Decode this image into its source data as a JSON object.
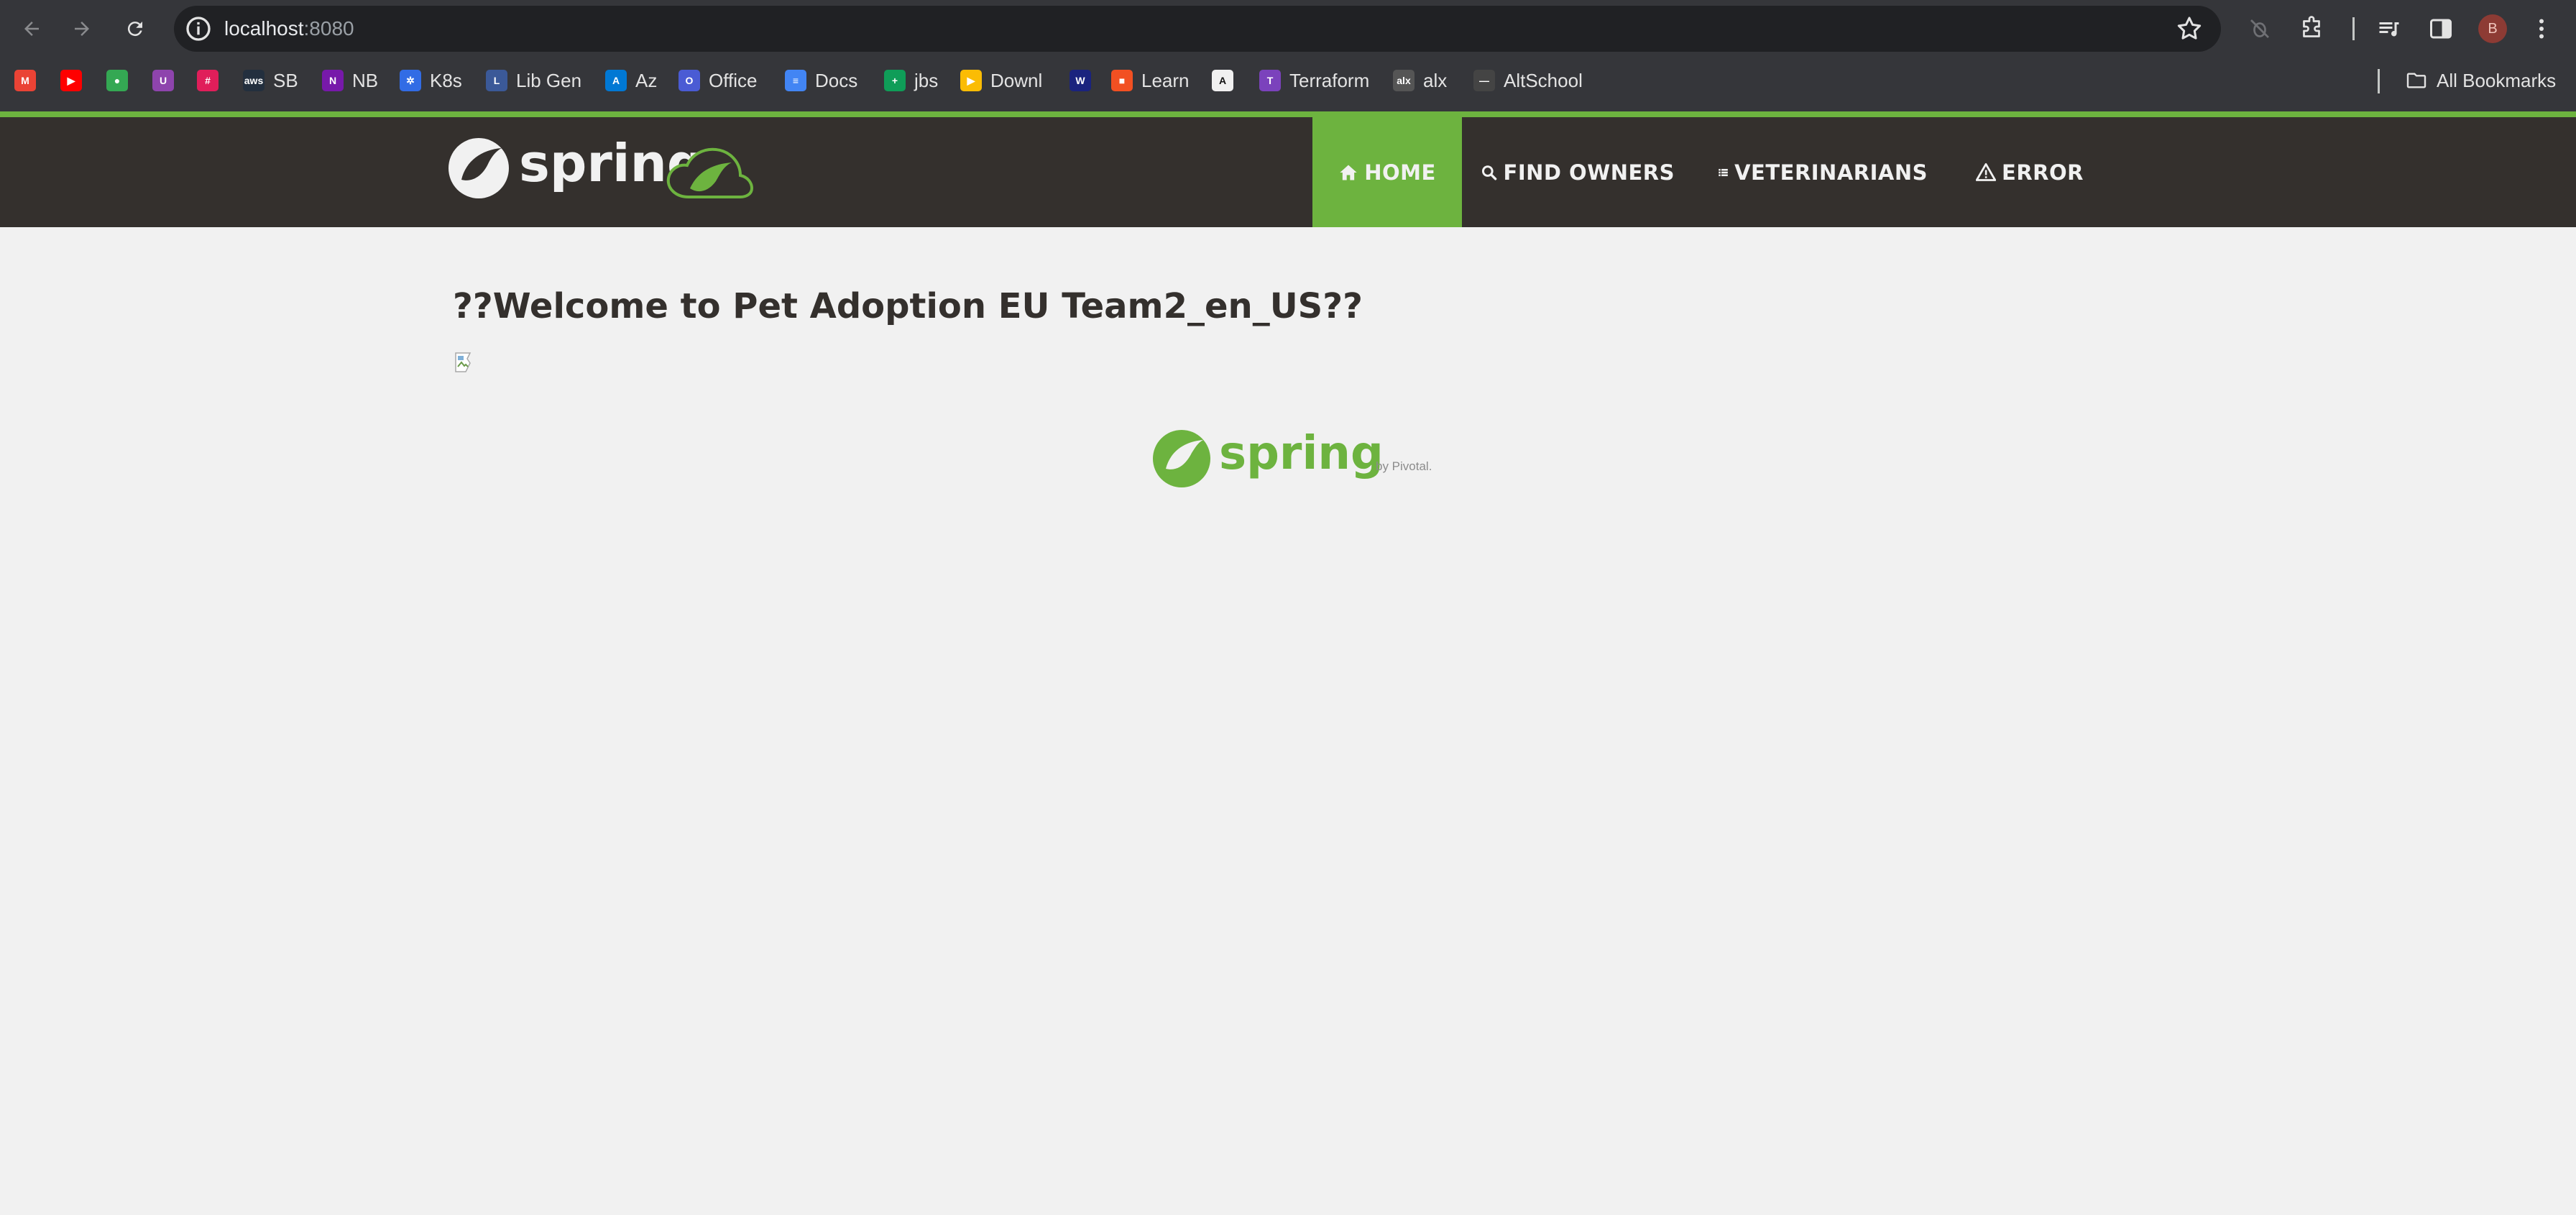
{
  "browser": {
    "url_host": "localhost",
    "url_port": ":8080",
    "profile_initial": "B"
  },
  "bookmarks": [
    {
      "label": "",
      "icon": "gmail-icon",
      "color": "#ea4335"
    },
    {
      "label": "",
      "icon": "youtube-icon",
      "color": "#ff0000"
    },
    {
      "label": "",
      "icon": "maps-icon",
      "color": "#34a853"
    },
    {
      "label": "",
      "icon": "extension-u-icon",
      "color": "#8e44ad"
    },
    {
      "label": "",
      "icon": "slack-icon",
      "color": "#e01e5a"
    },
    {
      "label": "SB",
      "icon": "aws-icon",
      "color": "#232f3e"
    },
    {
      "label": "NB",
      "icon": "onenote-icon",
      "color": "#7719aa"
    },
    {
      "label": "K8s",
      "icon": "kubernetes-icon",
      "color": "#326ce5"
    },
    {
      "label": "Lib Gen",
      "icon": "libgen-icon",
      "color": "#3b5998"
    },
    {
      "label": "Az",
      "icon": "azure-icon",
      "color": "#0078d4"
    },
    {
      "label": "Office",
      "icon": "office-icon",
      "color": "#4a5bd4"
    },
    {
      "label": "Docs",
      "icon": "docs-icon",
      "color": "#4285f4"
    },
    {
      "label": "jbs",
      "icon": "sheets-icon",
      "color": "#0f9d58"
    },
    {
      "label": "Downl",
      "icon": "play-icon",
      "color": "#fbbc04"
    },
    {
      "label": "",
      "icon": "w-icon",
      "color": "#1a237e"
    },
    {
      "label": "Learn",
      "icon": "microsoft-icon",
      "color": "#f25022"
    },
    {
      "label": "",
      "icon": "anthropic-icon",
      "color": "#f0f0f0"
    },
    {
      "label": "Terraform",
      "icon": "terraform-icon",
      "color": "#7b42bc"
    },
    {
      "label": "alx",
      "icon": "alx-icon",
      "color": "#555555"
    },
    {
      "label": "AltSchool",
      "icon": "altschool-icon",
      "color": "#444444"
    }
  ],
  "all_bookmarks_label": "All Bookmarks",
  "nav": {
    "home": "HOME",
    "find_owners": "FIND OWNERS",
    "veterinarians": "VETERINARIANS",
    "error": "ERROR"
  },
  "main": {
    "welcome": "??Welcome to Pet Adoption EU Team2_en_US??"
  },
  "brand": {
    "logo_text": "spring",
    "footer_logo_text": "spring",
    "footer_by": "by Pivotal."
  },
  "colors": {
    "spring_green": "#6db33f",
    "navbar_bg": "#34302d",
    "page_bg": "#f1f1f1"
  }
}
